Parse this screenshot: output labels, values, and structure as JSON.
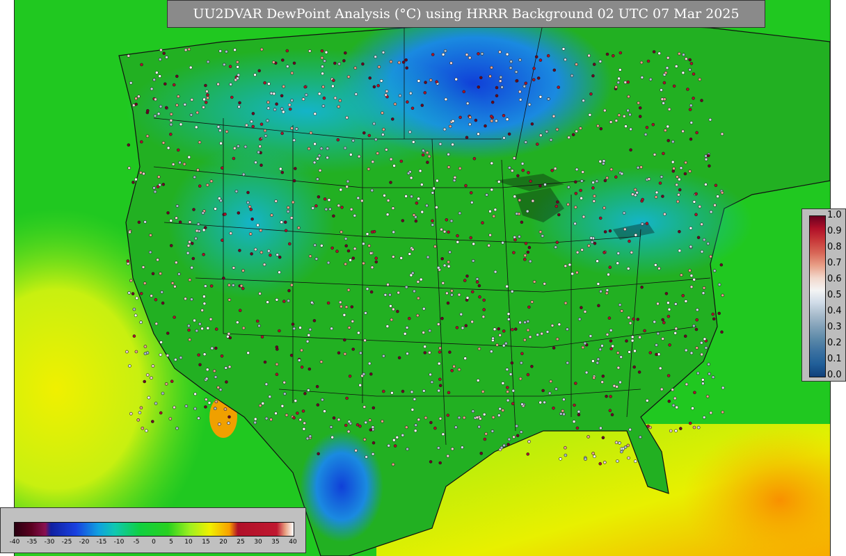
{
  "title": "UU2DVAR DewPoint Analysis (°C) using HRRR Background 02 UTC 07 Mar 2025",
  "colorbar_right": {
    "ticks": [
      "1.0",
      "0.9",
      "0.8",
      "0.7",
      "0.6",
      "0.5",
      "0.4",
      "0.3",
      "0.2",
      "0.1",
      "0.0"
    ],
    "colors": [
      "#6a0020",
      "#b01028",
      "#c83a3a",
      "#d86858",
      "#e8a088",
      "#f2d8cc",
      "#f4f4f4",
      "#d0dce8",
      "#a8bccc",
      "#80a0b8",
      "#5a88a8",
      "#3a70a0",
      "#205e98",
      "#10407a"
    ]
  },
  "colorbar_bottom": {
    "ticks": [
      "-40",
      "-35",
      "-30",
      "-25",
      "-20",
      "-15",
      "-10",
      "-5",
      "0",
      "5",
      "10",
      "15",
      "20",
      "25",
      "30",
      "35",
      "40"
    ]
  },
  "colors": {
    "ocean_green": "#1fcc1f",
    "land_green": "#2cb02c",
    "cold_blue": "#1a6fd8",
    "teal": "#18b8b8",
    "yellow": "#e8f000",
    "orange": "#f8a000"
  }
}
